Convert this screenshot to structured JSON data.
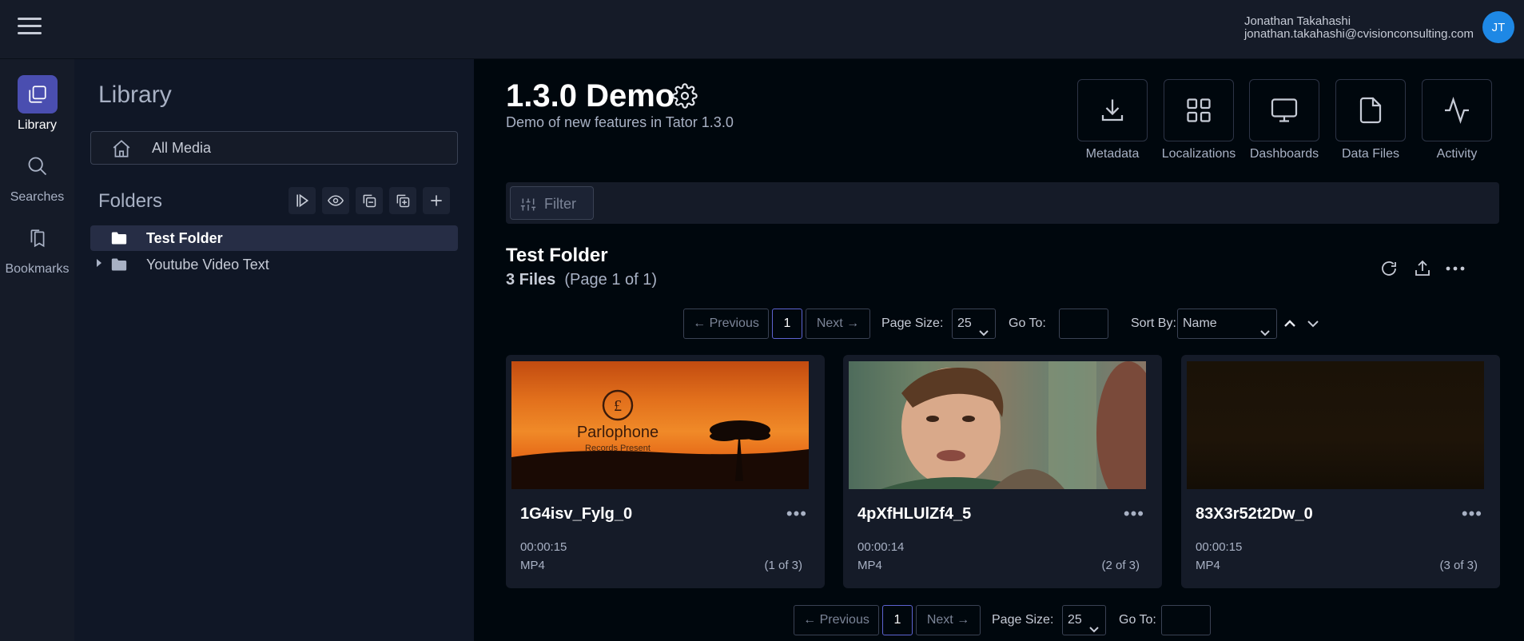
{
  "header": {
    "user_name": "Jonathan Takahashi",
    "user_email": "jonathan.takahashi@cvisionconsulting.com",
    "avatar_initials": "JT"
  },
  "rail": {
    "items": [
      {
        "label": "Library",
        "icon": "library-icon",
        "active": true
      },
      {
        "label": "Searches",
        "icon": "search-icon",
        "active": false
      },
      {
        "label": "Bookmarks",
        "icon": "bookmarks-icon",
        "active": false
      }
    ]
  },
  "library": {
    "title": "Library",
    "all_media_label": "All Media",
    "folders_title": "Folders",
    "folders": [
      {
        "label": "Test Folder",
        "selected": true,
        "has_children": false
      },
      {
        "label": "Youtube Video Text",
        "selected": false,
        "has_children": true
      }
    ]
  },
  "project": {
    "title": "1.3.0 Demo",
    "subtitle": "Demo of new features in Tator 1.3.0"
  },
  "quick_actions": [
    {
      "label": "Metadata",
      "icon": "download-icon"
    },
    {
      "label": "Localizations",
      "icon": "grid-icon"
    },
    {
      "label": "Dashboards",
      "icon": "monitor-icon"
    },
    {
      "label": "Data Files",
      "icon": "file-icon"
    },
    {
      "label": "Activity",
      "icon": "activity-icon"
    }
  ],
  "filter": {
    "label": "Filter"
  },
  "folder_view": {
    "title": "Test Folder",
    "file_count": "3 Files",
    "page_info": "(Page 1 of 1)"
  },
  "pagination": {
    "previous": "← Previous",
    "next": "Next →",
    "current_page": "1",
    "page_size_label": "Page Size:",
    "page_size": "25",
    "goto_label": "Go To:",
    "sort_by_label": "Sort By:",
    "sort_by": "Name"
  },
  "cards": [
    {
      "name": "1G4isv_Fylg_0",
      "duration": "00:00:15",
      "type": "MP4",
      "position": "(1 of 3)",
      "thumb_text": "Parlophone",
      "thumb_sub": "Records Present"
    },
    {
      "name": "4pXfHLUlZf4_5",
      "duration": "00:00:14",
      "type": "MP4",
      "position": "(2 of 3)"
    },
    {
      "name": "83X3r52t2Dw_0",
      "duration": "00:00:15",
      "type": "MP4",
      "position": "(3 of 3)"
    }
  ],
  "colors": {
    "accent": "#4a4eb0",
    "avatar": "#1e88e5",
    "background": "#00070d",
    "panel": "#151b28"
  }
}
